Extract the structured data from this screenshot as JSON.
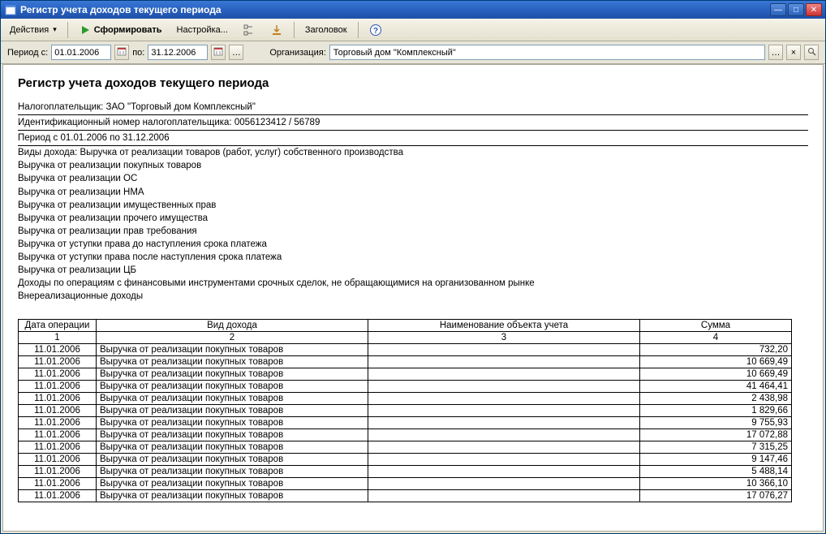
{
  "window_title": "Регистр учета доходов текущего периода",
  "toolbar": {
    "actions_label": "Действия",
    "form_label": "Сформировать",
    "settings_label": "Настройка...",
    "header_label": "Заголовок"
  },
  "filter": {
    "period_from_label": "Период с:",
    "date_from": "01.01.2006",
    "to_label": "по:",
    "date_to": "31.12.2006",
    "org_label": "Организация:",
    "org_value": "Торговый дом \"Комплексный\""
  },
  "report": {
    "title": "Регистр учета доходов текущего периода",
    "taxpayer": "Налогоплательщик: ЗАО \"Торговый дом Комплексный\"",
    "inn": "Идентификационный номер налогоплательщика: 0056123412 / 56789",
    "period": "Период с 01.01.2006 по 31.12.2006",
    "types_prefix": "Виды дохода: ",
    "types": [
      "Выручка от реализации товаров (работ, услуг) собственного производства",
      "Выручка от реализации покупных товаров",
      "Выручка от реализации ОС",
      "Выручка от реализации НМА",
      "Выручка от реализации имущественных прав",
      "Выручка от реализации прочего имущества",
      "Выручка от реализации прав требования",
      "Выручка от уступки права до наступления срока платежа",
      "Выручка от уступки права после наступления срока платежа",
      "Выручка от реализации ЦБ",
      "Доходы по операциям с финансовыми инструментами срочных сделок, не обращающимися на организованном рынке",
      "Внереализационные доходы"
    ]
  },
  "table": {
    "headers": [
      "Дата операции",
      "Вид дохода",
      "Наименование объекта учета",
      "Сумма"
    ],
    "num_headers": [
      "1",
      "2",
      "3",
      "4"
    ],
    "rows": [
      {
        "date": "11.01.2006",
        "type": "Выручка от реализации покупных товаров",
        "obj": "",
        "sum": "732,20"
      },
      {
        "date": "11.01.2006",
        "type": "Выручка от реализации покупных товаров",
        "obj": "",
        "sum": "10 669,49"
      },
      {
        "date": "11.01.2006",
        "type": "Выручка от реализации покупных товаров",
        "obj": "",
        "sum": "10 669,49"
      },
      {
        "date": "11.01.2006",
        "type": "Выручка от реализации покупных товаров",
        "obj": "",
        "sum": "41 464,41"
      },
      {
        "date": "11.01.2006",
        "type": "Выручка от реализации покупных товаров",
        "obj": "",
        "sum": "2 438,98"
      },
      {
        "date": "11.01.2006",
        "type": "Выручка от реализации покупных товаров",
        "obj": "",
        "sum": "1 829,66"
      },
      {
        "date": "11.01.2006",
        "type": "Выручка от реализации покупных товаров",
        "obj": "",
        "sum": "9 755,93"
      },
      {
        "date": "11.01.2006",
        "type": "Выручка от реализации покупных товаров",
        "obj": "",
        "sum": "17 072,88"
      },
      {
        "date": "11.01.2006",
        "type": "Выручка от реализации покупных товаров",
        "obj": "",
        "sum": "7 315,25"
      },
      {
        "date": "11.01.2006",
        "type": "Выручка от реализации покупных товаров",
        "obj": "",
        "sum": "9 147,46"
      },
      {
        "date": "11.01.2006",
        "type": "Выручка от реализации покупных товаров",
        "obj": "",
        "sum": "5 488,14"
      },
      {
        "date": "11.01.2006",
        "type": "Выручка от реализации покупных товаров",
        "obj": "",
        "sum": "10 366,10"
      },
      {
        "date": "11.01.2006",
        "type": "Выручка от реализации покупных товаров",
        "obj": "",
        "sum": "17 076,27"
      }
    ]
  }
}
